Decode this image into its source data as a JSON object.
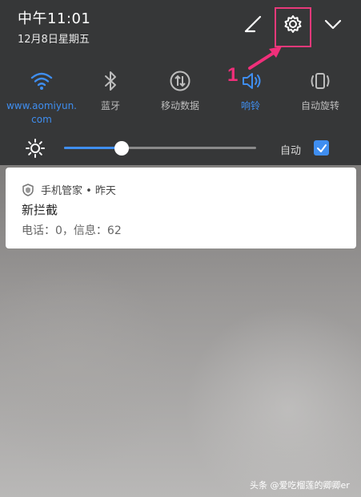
{
  "status": {
    "time": "中午11:01",
    "date": "12月8日星期五"
  },
  "top_buttons": {
    "edit_icon": "edit-icon",
    "settings_icon": "gear-icon",
    "expand_icon": "chevron-down-icon"
  },
  "quick_tiles": [
    {
      "label": "www.aomiyun.\ncom",
      "icon": "wifi-icon",
      "active": true
    },
    {
      "label": "蓝牙",
      "icon": "bluetooth-icon",
      "active": false
    },
    {
      "label": "移动数据",
      "icon": "mobile-data-icon",
      "active": false
    },
    {
      "label": "响铃",
      "icon": "sound-icon",
      "active": true
    },
    {
      "label": "自动旋转",
      "icon": "rotate-icon",
      "active": false
    }
  ],
  "brightness": {
    "level": 0.3,
    "auto_label": "自动",
    "auto_checked": true
  },
  "notification": {
    "app": "手机管家 • 昨天",
    "title": "新拦截",
    "body": "电话：0，信息：62"
  },
  "annotation": {
    "number": "1"
  },
  "watermark": "头条 @爱吃榴莲的卿卿er",
  "colors": {
    "accent": "#3f8ef0",
    "annotation": "#e8397a",
    "panel": "#363738"
  }
}
